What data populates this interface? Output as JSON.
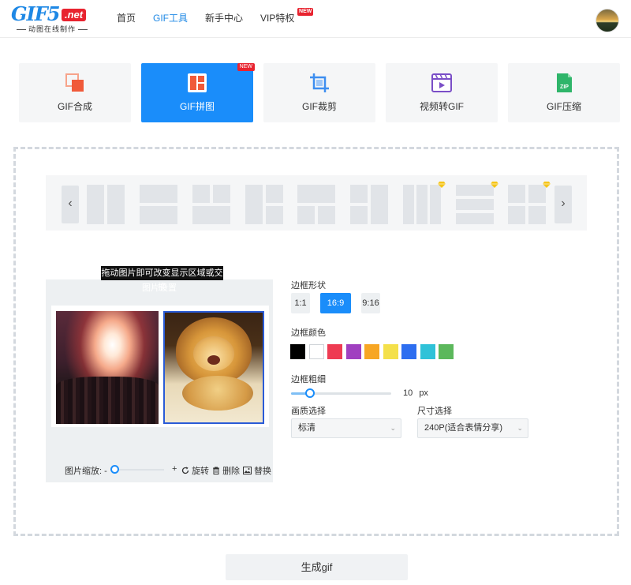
{
  "brand": {
    "word": "GIF5",
    "net": ".net",
    "tagline": "动图在线制作"
  },
  "nav": {
    "items": [
      {
        "label": "首页"
      },
      {
        "label": "GIF工具"
      },
      {
        "label": "新手中心"
      },
      {
        "label": "VIP特权",
        "badge": "NEW"
      }
    ],
    "active": "GIF工具"
  },
  "tools": [
    {
      "label": "GIF合成",
      "icon": "layers-icon"
    },
    {
      "label": "GIF拼图",
      "icon": "grid-icon",
      "badge": "NEW",
      "active": true
    },
    {
      "label": "GIF裁剪",
      "icon": "crop-icon"
    },
    {
      "label": "视频转GIF",
      "icon": "video-icon"
    },
    {
      "label": "GIF压缩",
      "icon": "zip-icon",
      "icon_text": "ZIP"
    }
  ],
  "strip": {
    "prev_icon": "chevron-left-icon",
    "next_icon": "chevron-right-icon",
    "prev_glyph": "‹",
    "next_glyph": "›"
  },
  "preview": {
    "tooltip": "拖动图片即可改变显示区域或交换",
    "subtitle": "图片设置",
    "zoom_label": "图片缩放: -",
    "zoom_plus": "+",
    "zoom_value": 0,
    "rotate": "旋转",
    "delete": "删除",
    "replace": "替换"
  },
  "settings": {
    "shape_label": "边框形状",
    "ratios": [
      "1:1",
      "16:9",
      "9:16"
    ],
    "active_ratio": "16:9",
    "color_label": "边框颜色",
    "colors": [
      "#000000",
      "#ffffff",
      "#ee3b52",
      "#a040c0",
      "#f7a623",
      "#f4e04a",
      "#2d6ef0",
      "#2fc2d8",
      "#5cb85c"
    ],
    "thickness_label": "边框粗细",
    "thickness_value": "10",
    "thickness_unit": "px",
    "quality_label": "画质选择",
    "quality_value": "标清",
    "size_label": "尺寸选择",
    "size_value": "240P(适合表情分享)"
  },
  "generate_label": "生成gif",
  "colors": {
    "accent": "#1a8dfa",
    "badge": "#e8232f",
    "vip": "#f5c518"
  }
}
